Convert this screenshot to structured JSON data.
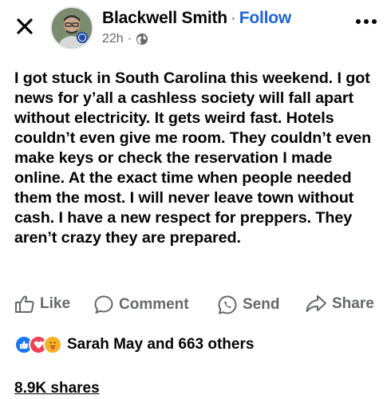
{
  "header": {
    "author_name": "Blackwell Smith",
    "separator": "·",
    "follow_label": "Follow",
    "time_ago": "22h",
    "meta_separator": "·",
    "privacy_icon": "globe-icon"
  },
  "post": {
    "text": "I got stuck in South Carolina this weekend. I got news for y’all a cashless society will fall apart without electricity. It gets weird fast. Hotels couldn’t even give me room. They couldn’t even make keys or check the reservation I made online. At the exact time when people needed them the most. I will never leave town without cash. I have a new respect for preppers. They aren’t crazy they are prepared."
  },
  "actions": {
    "like_label": "Like",
    "comment_label": "Comment",
    "send_label": "Send",
    "share_label": "Share"
  },
  "reactions": {
    "icons": [
      "like-icon",
      "love-icon",
      "care-icon"
    ],
    "summary": "Sarah May and 663 others"
  },
  "shares": {
    "label": "8.9K shares"
  },
  "colors": {
    "follow": "#1d64d8",
    "muted": "#65676b",
    "like_reaction": "#1877f2",
    "love_reaction": "#f33e58",
    "care_reaction": "#f7b125"
  }
}
